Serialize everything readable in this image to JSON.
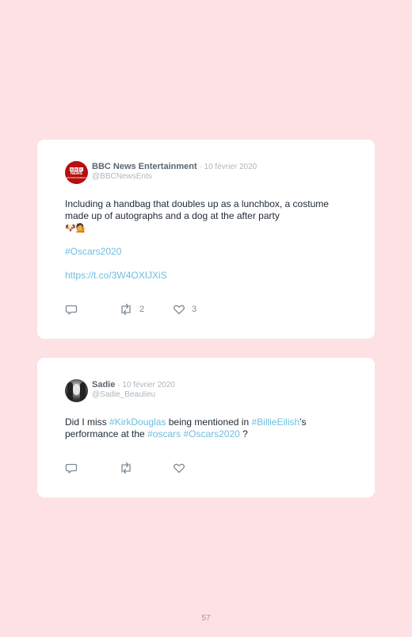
{
  "tweets": [
    {
      "display_name": "BBC News Entertainment",
      "separator": " · ",
      "date": "10 février 2020",
      "handle": "@BBCNewsEnts",
      "avatar_text": {
        "b1": "B",
        "b2": "B",
        "b3": "C",
        "line2": "NEWS",
        "line3": "ENTERTAINMENT"
      },
      "text_line_1": "Including a handbag that doubles up as a lunchbox, a costume made up of autographs and a dog at the after party",
      "emoji": "🐶💁",
      "hashtag": "#Oscars2020",
      "url": "https://t.co/3W4OXIJXiS",
      "retweet_count": "2",
      "like_count": "3"
    },
    {
      "display_name": "Sadie",
      "separator": " · ",
      "date": "10 février 2020",
      "handle": "@Sadie_Beaulieu",
      "text_parts": {
        "p1": "Did I miss ",
        "tag1": "#KirkDouglas",
        "p2": " being mentioned in ",
        "tag2": "#BillieEilish",
        "p3": "'s performance at the ",
        "tag3": "#oscars",
        "p4": " ",
        "tag4": "#Oscars2020",
        "p5": " ?"
      }
    }
  ],
  "page_number": "57",
  "colors": {
    "background": "#fde1e5",
    "card": "#ffffff",
    "link": "#6dbedf",
    "name": "#5b6670",
    "meta": "#b0b6bb",
    "icon": "#7f8a93"
  },
  "icons": {
    "reply": "reply-icon",
    "retweet": "retweet-icon",
    "like": "heart-icon"
  }
}
